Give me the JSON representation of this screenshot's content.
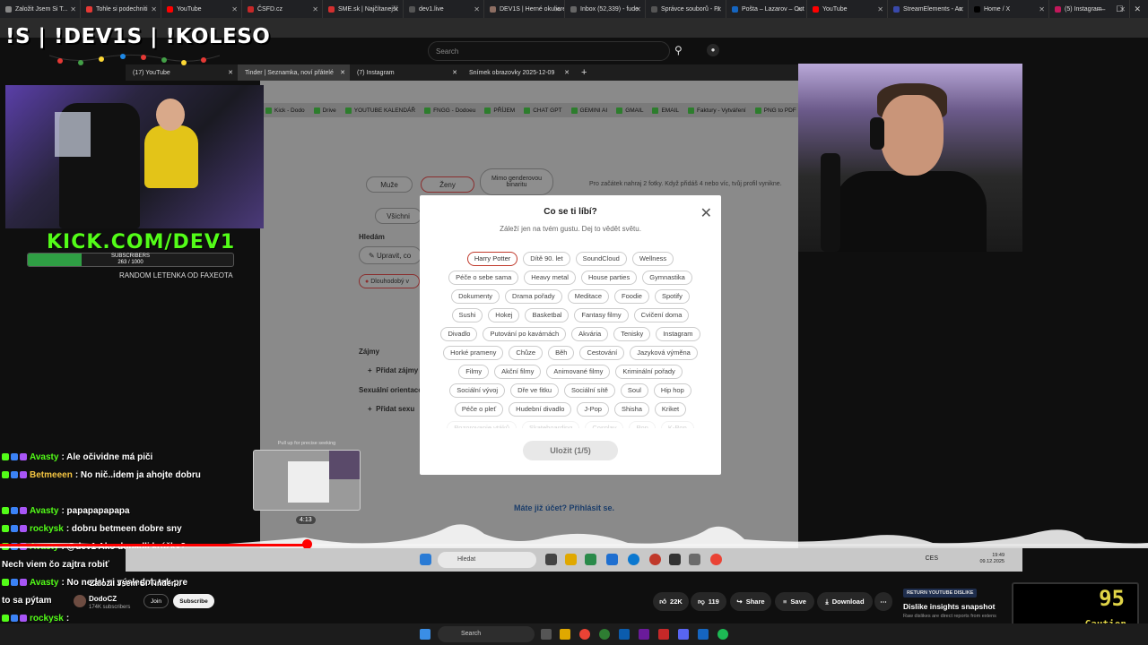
{
  "top_tabs": [
    {
      "label": "Založit Jsem Si T...",
      "color": "#888"
    },
    {
      "label": "Tohle si podechniti",
      "color": "#e53935"
    },
    {
      "label": "YouTube",
      "color": "#ff0000"
    },
    {
      "label": "ČSFD.cz",
      "color": "#c62828"
    },
    {
      "label": "SME.sk | Najčítanejší",
      "color": "#d32f2f"
    },
    {
      "label": "dev1.live",
      "color": "#555"
    },
    {
      "label": "DEV1S | Herné okuliare",
      "color": "#8d6e63"
    },
    {
      "label": "Inbox (52,339) - fude",
      "color": "#666"
    },
    {
      "label": "Správce souborů - FI",
      "color": "#555"
    },
    {
      "label": "Pošta – Lazarov – Out",
      "color": "#1565c0"
    },
    {
      "label": "YouTube",
      "color": "#ff0000"
    },
    {
      "label": "StreamElements - Ac",
      "color": "#3949ab"
    },
    {
      "label": "Home / X",
      "color": "#000"
    },
    {
      "label": "(5) Instagram",
      "color": "#c2185b"
    }
  ],
  "yt_search_placeholder": "Search",
  "stream_title": "!S | !DEV1S | !KOLESO",
  "kick_text": "KICK.COM/DEV1",
  "subscribers": {
    "label": "SUBSCRIBERS",
    "value": "263 / 1000",
    "fraction": 0.263
  },
  "random_text": "RANDOM LETENKA OD FAXEOTA",
  "inner_tabs": [
    {
      "label": "(17) YouTube",
      "active": false
    },
    {
      "label": "Tinder | Seznamka, noví přátelé",
      "active": true
    },
    {
      "label": "(7) Instagram",
      "active": false
    },
    {
      "label": "Snímek obrazovky 2025-12-09",
      "active": false
    }
  ],
  "bookmarks": [
    "Kick - Dodo",
    "Drive",
    "YOUTUBE KALENDÁŘ",
    "FNGG - Dodoeu",
    "PŘÍJEM",
    "CHAT GPT",
    "GEMINI AI",
    "GMAIL",
    "EMAIL",
    "Faktury - Vytváření",
    "PNG to PDF"
  ],
  "bg_page": {
    "gender_options": [
      "Muže",
      "Ženy",
      "Mimo genderovou binaritu"
    ],
    "everyone": "Všichni",
    "hint": "Pro začátek nahraj 2 fotky. Když přidáš 4 nebo víc, tvůj profil vynikne.",
    "looking_label": "Hledám",
    "edit": "Upravit, co",
    "long_term": "Dlouhodobý v",
    "interests_label": "Zájmy",
    "add_interests": "Přidat zájmy",
    "orientation_label": "Sexuální orientace",
    "add_orientation": "Přidat sexu"
  },
  "modal": {
    "title": "Co se ti líbí?",
    "subtitle": "Záleží jen na tvém gustu. Dej to vědět světu.",
    "chip_rows": [
      [
        "Harry Potter",
        "Dítě 90. let",
        "SoundCloud",
        "Wellness"
      ],
      [
        "Péče o sebe sama",
        "Heavy metal",
        "House parties",
        "Gymnastika"
      ],
      [
        "Dokumenty",
        "Drama pořady",
        "Meditace",
        "Foodie",
        "Spotify"
      ],
      [
        "Sushi",
        "Hokej",
        "Basketbal",
        "Fantasy filmy",
        "Cvičení doma"
      ],
      [
        "Divadlo",
        "Putování po kavárnách",
        "Akvária",
        "Tenisky",
        "Instagram"
      ],
      [
        "Horké prameny",
        "Chůze",
        "Běh",
        "Cestování",
        "Jazyková výměna"
      ],
      [
        "Filmy",
        "Akční filmy",
        "Animované filmy",
        "Kriminální pořady"
      ],
      [
        "Sociální vývoj",
        "Dře ve fitku",
        "Sociální sítě",
        "Soul",
        "Hip hop"
      ],
      [
        "Péče o pleť",
        "Hudební divadlo",
        "J-Pop",
        "Shisha",
        "Kriket"
      ],
      [
        "Pozorovanie vtáků",
        "Skateboarding",
        "Cosplay",
        "Pop",
        "K-Pop"
      ]
    ],
    "selected": "Harry Potter",
    "save_label": "Uložit (1/5)"
  },
  "login_link": "Máte již účet? Přihlásit se.",
  "chat": [
    {
      "user": "Avasty",
      "color": "#53fc18",
      "text": ": Ale očividne má piči"
    },
    {
      "user": "Betmeeen",
      "color": "#f4c542",
      "text": ": No nič..idem ja ahojte dobru"
    },
    {
      "user": "",
      "color": "#f4c542",
      "text": ""
    },
    {
      "user": "Avasty",
      "color": "#53fc18",
      "text": ": papapapapapa"
    },
    {
      "user": "rockysk",
      "color": "#53fc18",
      "text": ": dobru betmeen dobre sny"
    },
    {
      "user": "Avasty",
      "color": "#53fc18",
      "text": ": @dev1 Ako dopadli krúžky?"
    },
    {
      "user": "",
      "color": "#fff",
      "text": "Nech viem čo zajtra robiť"
    },
    {
      "user": "Avasty",
      "color": "#53fc18",
      "text": ": No nedal si výsledok tak pre"
    },
    {
      "user": "",
      "color": "#fff",
      "text": "to sa pýtam"
    },
    {
      "user": "rockysk",
      "color": "#53fc18",
      "text": ":"
    },
    {
      "user": "rockysk",
      "color": "#53fc18",
      "text": ":"
    }
  ],
  "seek": {
    "hint": "Pull up for precise seeking",
    "time": "4:13",
    "progress": 0.267
  },
  "inner_taskbar": {
    "search": "Hledat",
    "clock_time": "19:49",
    "clock_date": "09.12.2025",
    "lang": "CES"
  },
  "overlay_title": "Založil Jsem Si Tinder...",
  "channel": {
    "name": "DodoCZ",
    "subs": "174K subscribers",
    "join": "Join",
    "subscribe": "Subscribe"
  },
  "actions": {
    "likes": "22K",
    "dislikes": "119",
    "share": "Share",
    "save": "Save",
    "download": "Download"
  },
  "dislike_panel": {
    "tag": "RETURN YOUTUBE DISLIKE",
    "title": "Dislike insights snapshot",
    "desc": "Raw dislikes are direct reports from extens"
  },
  "gauge": {
    "value": "95",
    "label": "Caution"
  },
  "taskbar": {
    "search": "Search"
  }
}
